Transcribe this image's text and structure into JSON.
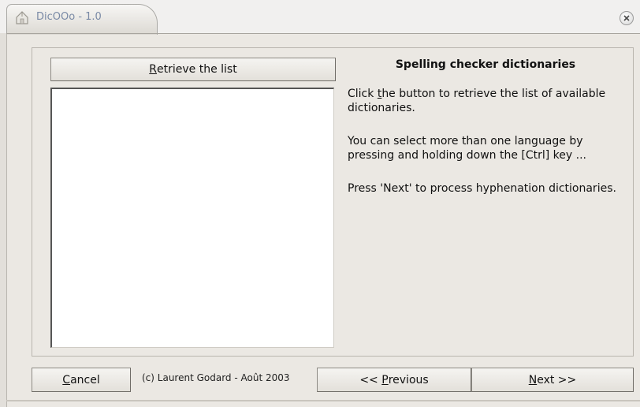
{
  "window": {
    "title": "DicOOo - 1.0",
    "app_icon": "house-icon",
    "close_icon": "close-icon"
  },
  "panel": {
    "retrieve_button": {
      "prefix": "",
      "mnemonic": "R",
      "rest": "etrieve the list"
    },
    "heading": "Spelling checker dictionaries",
    "para1": {
      "before": "Click ",
      "mnemonic": "t",
      "after": "he button to retrieve the list of available dictionaries."
    },
    "para2": "You can select more than one language by pressing and holding down  the [Ctrl] key ...",
    "para3": "Press 'Next' to process hyphenation dictionaries."
  },
  "footer": {
    "cancel": {
      "mnemonic": "C",
      "rest": "ancel"
    },
    "copyright": "(c) Laurent Godard - Août 2003",
    "previous": {
      "prefix": "<< ",
      "mnemonic": "P",
      "rest": "revious"
    },
    "next": {
      "mnemonic": "N",
      "rest": "ext >>"
    }
  },
  "colors": {
    "background": "#ebe8e3",
    "title_text": "#7a8aa6"
  }
}
